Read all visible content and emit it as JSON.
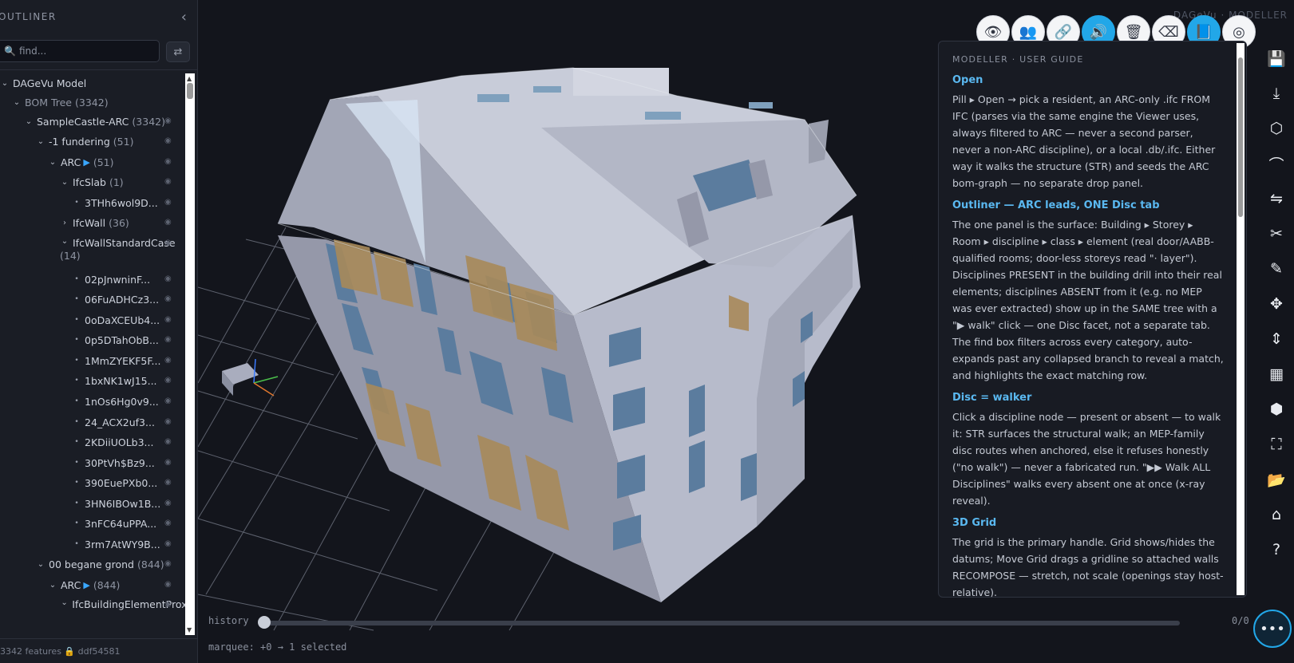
{
  "outliner": {
    "title": "OUTLINER",
    "search_placeholder": "find...",
    "footer": "3342 features 🔒 ddf54581",
    "rows": [
      {
        "label": "DAGeVu Model",
        "count": "",
        "chev": "⌄",
        "indent": 0,
        "arc": false,
        "eye": false,
        "dim": false
      },
      {
        "label": "BOM Tree",
        "count": "(3342)",
        "chev": "⌄",
        "indent": 1,
        "arc": false,
        "eye": false,
        "dim": true
      },
      {
        "label": "SampleCastle-ARC",
        "count": "(3342)",
        "chev": "⌄",
        "indent": 2,
        "arc": false,
        "eye": true,
        "dim": false
      },
      {
        "label": "-1 fundering",
        "count": "(51)",
        "chev": "⌄",
        "indent": 3,
        "arc": false,
        "eye": true,
        "dim": false
      },
      {
        "label": "ARC",
        "count": "(51)",
        "chev": "⌄",
        "indent": 4,
        "arc": true,
        "eye": true,
        "dim": false
      },
      {
        "label": "IfcSlab",
        "count": "(1)",
        "chev": "⌄",
        "indent": 5,
        "arc": false,
        "eye": true,
        "dim": false
      },
      {
        "label": "3THh6wol9D...",
        "count": "",
        "chev": "•",
        "indent": 6,
        "arc": false,
        "eye": true,
        "dim": false
      },
      {
        "label": "IfcWall",
        "count": "(36)",
        "chev": "›",
        "indent": 5,
        "arc": false,
        "eye": true,
        "dim": false
      },
      {
        "label": "IfcWallStandardCase",
        "count": "(14)",
        "chev": "⌄",
        "indent": 5,
        "arc": false,
        "eye": true,
        "dim": false,
        "wrap": true
      },
      {
        "label": "02pJnwninF...",
        "count": "",
        "chev": "•",
        "indent": 6,
        "arc": false,
        "eye": true,
        "dim": false
      },
      {
        "label": "06FuADHCz3...",
        "count": "",
        "chev": "•",
        "indent": 6,
        "arc": false,
        "eye": true,
        "dim": false
      },
      {
        "label": "0oDaXCEUb4...",
        "count": "",
        "chev": "•",
        "indent": 6,
        "arc": false,
        "eye": true,
        "dim": false
      },
      {
        "label": "0p5DTahObB...",
        "count": "",
        "chev": "•",
        "indent": 6,
        "arc": false,
        "eye": true,
        "dim": false
      },
      {
        "label": "1MmZYEKF5F...",
        "count": "",
        "chev": "•",
        "indent": 6,
        "arc": false,
        "eye": true,
        "dim": false
      },
      {
        "label": "1bxNK1wJ15...",
        "count": "",
        "chev": "•",
        "indent": 6,
        "arc": false,
        "eye": true,
        "dim": false
      },
      {
        "label": "1nOs6Hg0v9...",
        "count": "",
        "chev": "•",
        "indent": 6,
        "arc": false,
        "eye": true,
        "dim": false
      },
      {
        "label": "24_ACX2uf3...",
        "count": "",
        "chev": "•",
        "indent": 6,
        "arc": false,
        "eye": true,
        "dim": false
      },
      {
        "label": "2KDiiUOLb3...",
        "count": "",
        "chev": "•",
        "indent": 6,
        "arc": false,
        "eye": true,
        "dim": false
      },
      {
        "label": "30PtVh$Bz9...",
        "count": "",
        "chev": "•",
        "indent": 6,
        "arc": false,
        "eye": true,
        "dim": false
      },
      {
        "label": "390EuePXb0...",
        "count": "",
        "chev": "•",
        "indent": 6,
        "arc": false,
        "eye": true,
        "dim": false
      },
      {
        "label": "3HN6IBOw1B...",
        "count": "",
        "chev": "•",
        "indent": 6,
        "arc": false,
        "eye": true,
        "dim": false
      },
      {
        "label": "3nFC64uPPA...",
        "count": "",
        "chev": "•",
        "indent": 6,
        "arc": false,
        "eye": true,
        "dim": false
      },
      {
        "label": "3rm7AtWY9B...",
        "count": "",
        "chev": "•",
        "indent": 6,
        "arc": false,
        "eye": true,
        "dim": false
      },
      {
        "label": "00 begane grond",
        "count": "(844)",
        "chev": "⌄",
        "indent": 3,
        "arc": false,
        "eye": true,
        "dim": false
      },
      {
        "label": "ARC",
        "count": "(844)",
        "chev": "⌄",
        "indent": 4,
        "arc": true,
        "eye": true,
        "dim": false
      },
      {
        "label": "IfcBuildingElementProxy",
        "count": "",
        "chev": "⌄",
        "indent": 5,
        "arc": false,
        "eye": true,
        "dim": false,
        "wrap": true
      }
    ]
  },
  "viewport": {
    "brand": "DAGeVu · MODELLER",
    "toolbar": [
      {
        "name": "visibility-toggle",
        "icon": "eye-icon",
        "glyph": "👁",
        "active": false
      },
      {
        "name": "users",
        "icon": "users-icon",
        "glyph": "👥",
        "active": false
      },
      {
        "name": "link",
        "icon": "link-icon",
        "glyph": "🔗",
        "active": false
      },
      {
        "name": "sound",
        "icon": "speaker-icon",
        "glyph": "🔊",
        "active": true
      },
      {
        "name": "delete",
        "icon": "trash-icon",
        "glyph": "🗑",
        "active": false
      },
      {
        "name": "clear",
        "icon": "backspace-icon",
        "glyph": "⌫",
        "active": false
      },
      {
        "name": "guide",
        "icon": "book-icon",
        "glyph": "📘",
        "active": true
      },
      {
        "name": "compare",
        "icon": "overlap-circles-icon",
        "glyph": "◎",
        "active": false
      }
    ],
    "rail": [
      {
        "name": "save",
        "icon": "save-icon",
        "glyph": "💾"
      },
      {
        "name": "download",
        "icon": "download-icon",
        "glyph": "⤓"
      },
      {
        "name": "model",
        "icon": "cube-icon",
        "glyph": "⬡"
      },
      {
        "name": "curve",
        "icon": "curve-icon",
        "glyph": "⌒"
      },
      {
        "name": "route",
        "icon": "route-icon",
        "glyph": "⇋"
      },
      {
        "name": "cut",
        "icon": "scissors-icon",
        "glyph": "✂"
      },
      {
        "name": "edit",
        "icon": "pencil-icon",
        "glyph": "✎"
      },
      {
        "name": "move",
        "icon": "move-icon",
        "glyph": "✥"
      },
      {
        "name": "vertical-move",
        "icon": "vertical-arrows-icon",
        "glyph": "⇕"
      },
      {
        "name": "grid",
        "icon": "grid-icon",
        "glyph": "▦"
      },
      {
        "name": "box",
        "icon": "box-icon",
        "glyph": "⬢"
      },
      {
        "name": "fullscreen",
        "icon": "fullscreen-icon",
        "glyph": "⛶"
      },
      {
        "name": "open-folder",
        "icon": "folder-icon",
        "glyph": "📂"
      },
      {
        "name": "home",
        "icon": "home-icon",
        "glyph": "⌂"
      },
      {
        "name": "help",
        "icon": "help-icon",
        "glyph": "?"
      }
    ],
    "more_glyph": "•••",
    "history": {
      "label": "history",
      "count": "0/0",
      "progress": 0
    },
    "status": "marquee: +0 → 1 selected"
  },
  "guide": {
    "kicker": "MODELLER · USER GUIDE",
    "sections": [
      {
        "heading": "Open",
        "body": "Pill ▸ Open → pick a resident, an ARC-only .ifc FROM IFC (parses via the same engine the Viewer uses, always filtered to ARC — never a second parser, never a non-ARC discipline), or a local .db/.ifc. Either way it walks the structure (STR) and seeds the ARC bom-graph — no separate drop panel."
      },
      {
        "heading": "Outliner — ARC leads, ONE Disc tab",
        "body": "The one panel is the surface: Building ▸ Storey ▸ Room ▸ discipline ▸ class ▸ element (real door/AABB-qualified rooms; door-less storeys read \"· layer\"). Disciplines PRESENT in the building drill into their real elements; disciplines ABSENT from it (e.g. no MEP was ever extracted) show up in the SAME tree with a \"▶ walk\" click — one Disc facet, not a separate tab. The find box filters across every category, auto-expands past any collapsed branch to reveal a match, and highlights the exact matching row."
      },
      {
        "heading": "Disc = walker",
        "body": "Click a discipline node — present or absent — to walk it: STR surfaces the structural walk; an MEP-family disc routes when anchored, else it refuses honestly (\"no walk\") — never a fabricated run. \"▶▶ Walk ALL Disciplines\" walks every absent one at once (x-ray reveal)."
      },
      {
        "heading": "3D Grid",
        "body": "The grid is the primary handle. Grid shows/hides the datums; Move Grid drags a gridline so attached walls RECOMPOSE — stretch, not scale (openings stay host-relative)."
      }
    ]
  },
  "colors": {
    "accent": "#22a7e8",
    "heading": "#5ab8f0",
    "background": "#13151c",
    "panel": "#1a1d25",
    "facade": "#a9adbe",
    "window": "#5b7c9e",
    "door": "#a88a5a"
  }
}
